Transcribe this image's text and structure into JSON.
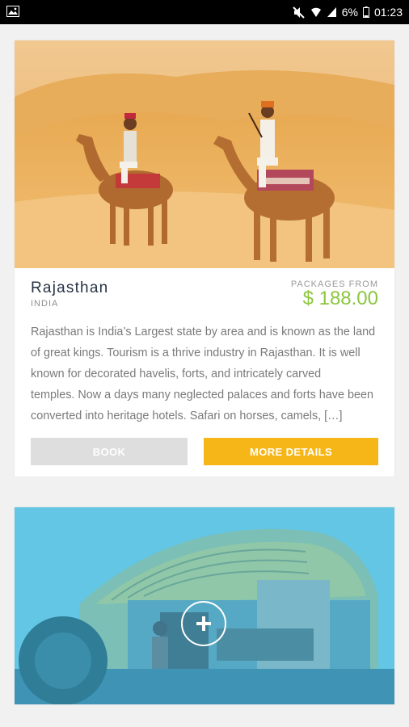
{
  "status_bar": {
    "battery": "6%",
    "time": "01:23",
    "icons": [
      "gallery-icon",
      "mute-icon",
      "wifi-icon",
      "signal-icon",
      "battery-icon"
    ]
  },
  "cards": [
    {
      "title": "Rajasthan",
      "country": "INDIA",
      "price_label": "PACKAGES FROM",
      "price": "$ 188.00",
      "description": "Rajasthan is India’s Largest state by area and is known as the land of great kings. Tourism is a thrive industry in Rajasthan. It is well known for decorated havelis, forts, and intricately carved        temples. Now a days many neglected palaces and forts have been converted into heritage hotels. Safari on horses, camels, […]",
      "book_label": "BOOK",
      "more_label": "MORE DETAILS"
    }
  ],
  "colors": {
    "price": "#8cc63e",
    "more_button": "#f7b618",
    "book_button": "#dedede",
    "overlay": "#4fb8dc"
  }
}
